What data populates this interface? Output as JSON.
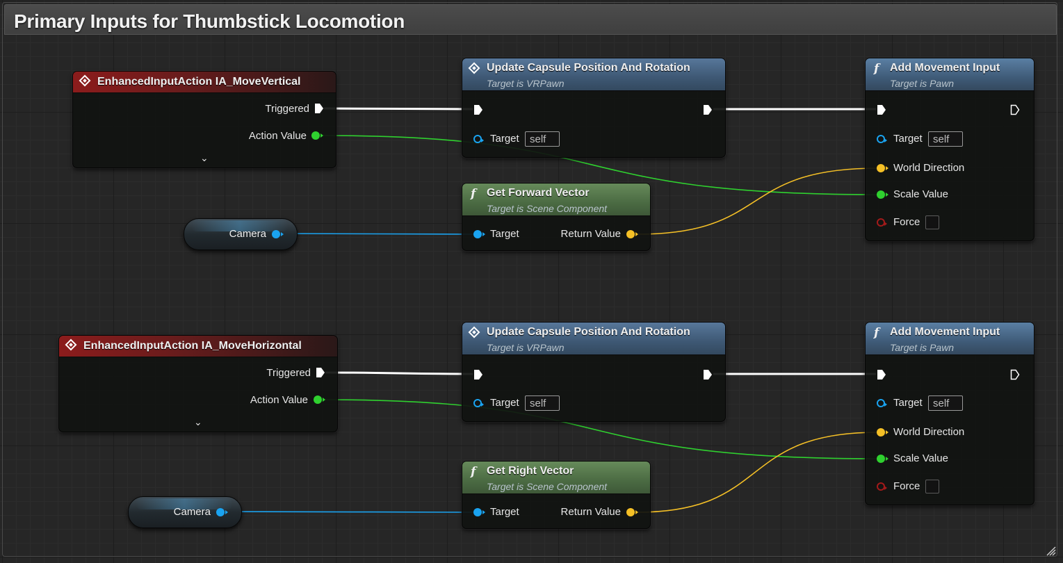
{
  "comment": {
    "title": "Primary Inputs for Thumbstick Locomotion"
  },
  "colors": {
    "exec_wire": "#ffffff",
    "float_wire": "#2fd12f",
    "object_wire": "#1aa3f0",
    "vector_wire": "#f5c026",
    "event_header": "#8c1c1c",
    "function_header": "#3e5874",
    "pure_header": "#4b6b43"
  },
  "vertical_group": {
    "event": {
      "title": "EnhancedInputAction IA_MoveVertical",
      "triggered": "Triggered",
      "action_value": "Action Value"
    },
    "update_capsule": {
      "title": "Update Capsule Position And Rotation",
      "subtitle": "Target is VRPawn",
      "target_label": "Target",
      "target_value": "self"
    },
    "camera": {
      "label": "Camera"
    },
    "forward_vector": {
      "title": "Get Forward Vector",
      "subtitle": "Target is Scene Component",
      "target_label": "Target",
      "return_label": "Return Value"
    },
    "add_movement": {
      "title": "Add Movement Input",
      "subtitle": "Target is Pawn",
      "target_label": "Target",
      "target_value": "self",
      "world_direction": "World Direction",
      "scale_value": "Scale Value",
      "force": "Force"
    }
  },
  "horizontal_group": {
    "event": {
      "title": "EnhancedInputAction IA_MoveHorizontal",
      "triggered": "Triggered",
      "action_value": "Action Value"
    },
    "update_capsule": {
      "title": "Update Capsule Position And Rotation",
      "subtitle": "Target is VRPawn",
      "target_label": "Target",
      "target_value": "self"
    },
    "camera": {
      "label": "Camera"
    },
    "right_vector": {
      "title": "Get Right Vector",
      "subtitle": "Target is Scene Component",
      "target_label": "Target",
      "return_label": "Return Value"
    },
    "add_movement": {
      "title": "Add Movement Input",
      "subtitle": "Target is Pawn",
      "target_label": "Target",
      "target_value": "self",
      "world_direction": "World Direction",
      "scale_value": "Scale Value",
      "force": "Force"
    }
  }
}
